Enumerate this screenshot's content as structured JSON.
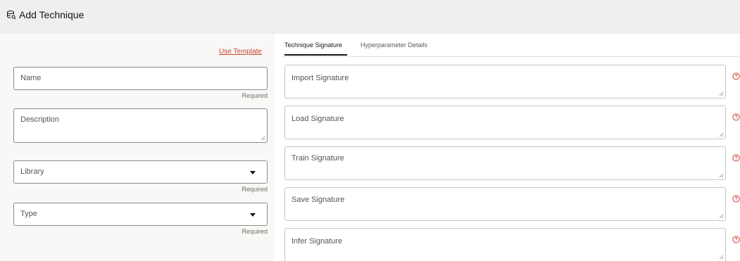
{
  "header": {
    "title": "Add Technique"
  },
  "form": {
    "use_template": "Use Template",
    "name_placeholder": "Name",
    "description_placeholder": "Description",
    "library_placeholder": "Library",
    "type_placeholder": "Type",
    "required_text": "Required"
  },
  "tabs": [
    {
      "label": "Technique Signature",
      "active": true
    },
    {
      "label": "Hyperparameter Details",
      "active": false
    }
  ],
  "signatures": [
    {
      "label": "Import Signature"
    },
    {
      "label": "Load Signature"
    },
    {
      "label": "Train Signature"
    },
    {
      "label": "Save Signature"
    },
    {
      "label": "Infer Signature"
    }
  ],
  "colors": {
    "accent": "#c74634",
    "header_bg": "#f1efed",
    "panel_bg": "#f9f8f6"
  }
}
